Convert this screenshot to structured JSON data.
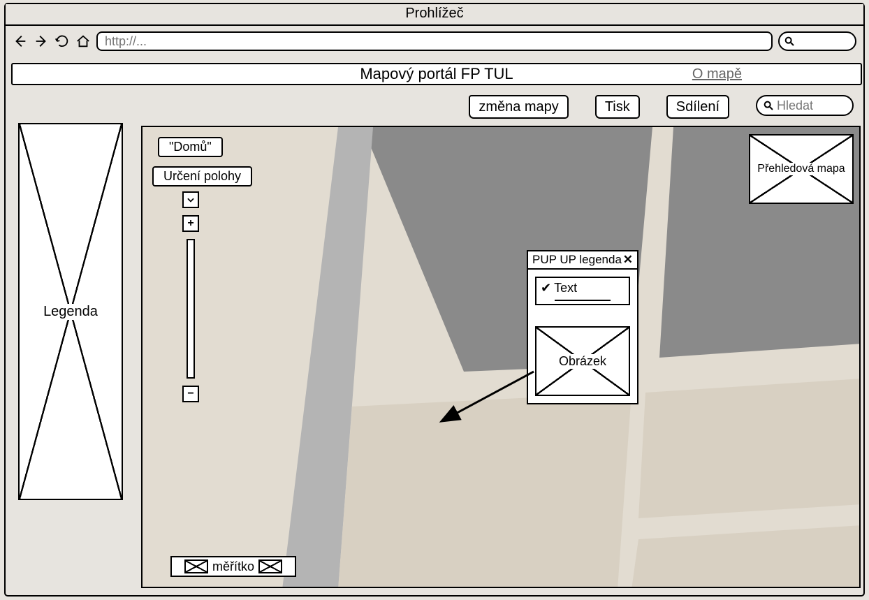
{
  "browser": {
    "title": "Prohlížeč",
    "url_placeholder": "http://..."
  },
  "header": {
    "title": "Mapový portál FP TUL",
    "about_link": "O mapě"
  },
  "toolbar": {
    "change_map": "změna mapy",
    "print": "Tisk",
    "share": "Sdílení",
    "search_placeholder": "Hledat"
  },
  "sidebar": {
    "legend_label": "Legenda"
  },
  "map_controls": {
    "home_label": "\"Domů\"",
    "geolocate_label": "Určení polohy"
  },
  "overview": {
    "label": "Přehledová mapa"
  },
  "scale": {
    "label": "měřítko"
  },
  "popup": {
    "title": "PUP UP legenda",
    "text_item": "Text",
    "image_label": "Obrázek"
  }
}
